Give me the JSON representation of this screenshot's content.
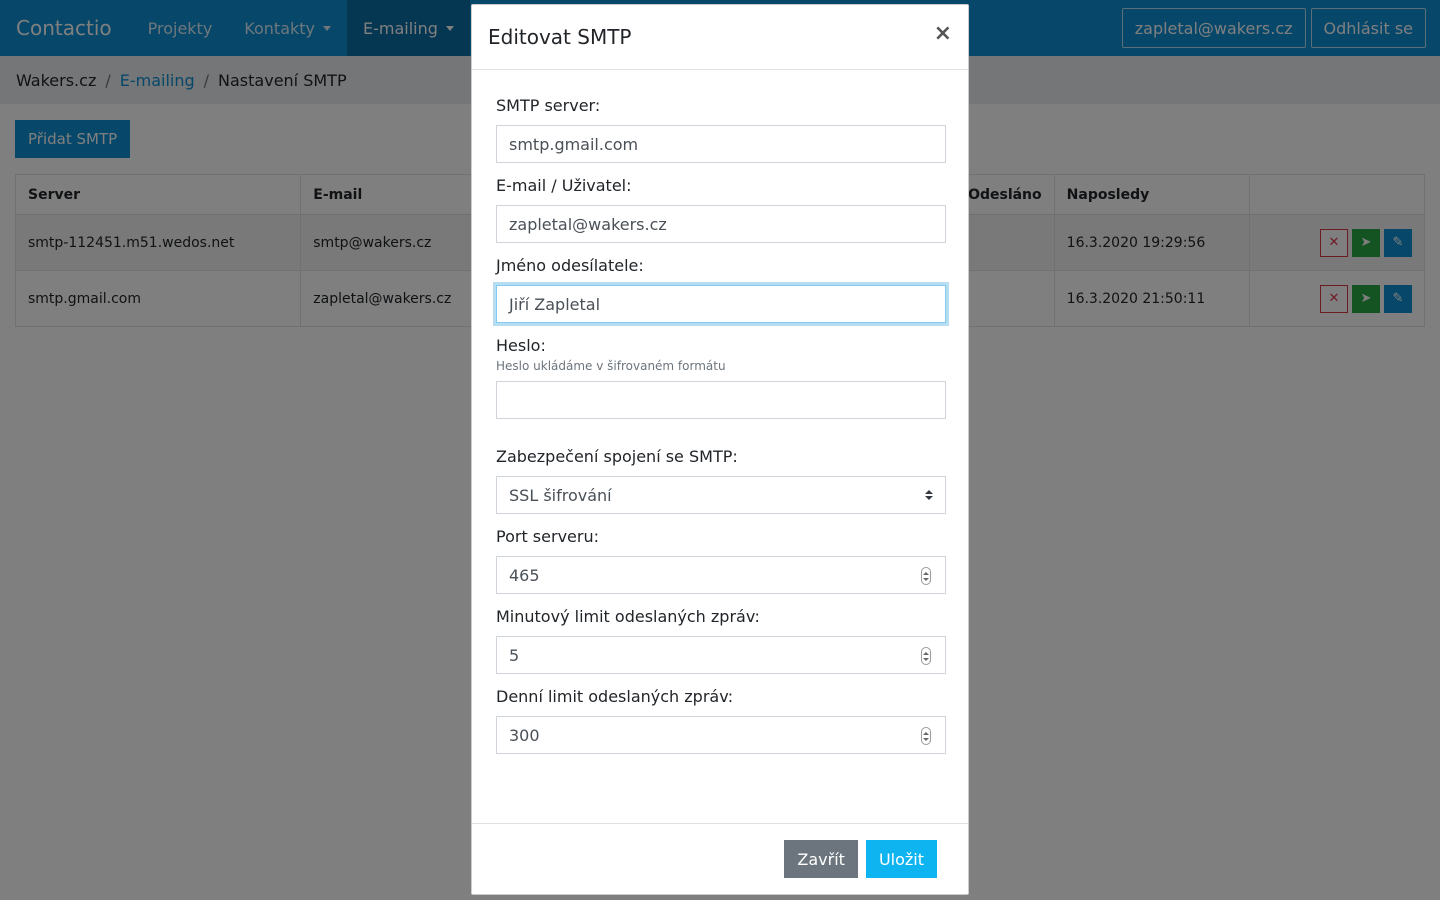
{
  "navbar": {
    "brand": "Contactio",
    "items": [
      {
        "label": "Projekty"
      },
      {
        "label": "Kontakty"
      },
      {
        "label": "E-mailing"
      }
    ],
    "user_email": "zapletal@wakers.cz",
    "logout_label": "Odhlásit se"
  },
  "breadcrumb": {
    "items": [
      "Wakers.cz",
      "E-mailing",
      "Nastavení SMTP"
    ],
    "separator": "/"
  },
  "add_button_label": "Přidat SMTP",
  "table": {
    "headers": [
      "Server",
      "E-mail",
      "",
      "Odesláno",
      "Naposledy",
      ""
    ],
    "visible_header_partial": "eslano",
    "rows": [
      {
        "server": "smtp-112451.m51.wedos.net",
        "email": "smtp@wakers.cz",
        "last": "16.3.2020 19:29:56"
      },
      {
        "server": "smtp.gmail.com",
        "email": "zapletal@wakers.cz",
        "last": "16.3.2020 21:50:11"
      }
    ]
  },
  "modal": {
    "title": "Editovat SMTP",
    "close_symbol": "×",
    "fields": {
      "smtp_server": {
        "label": "SMTP server:",
        "value": "smtp.gmail.com"
      },
      "email_user": {
        "label": "E-mail / Uživatel:",
        "value": "zapletal@wakers.cz"
      },
      "sender_name": {
        "label": "Jméno odesílatele:",
        "value": "Jiří Zapletal"
      },
      "password": {
        "label": "Heslo:",
        "help": "Heslo ukládáme v šifrovaném formátu",
        "value": ""
      },
      "security": {
        "label": "Zabezpečení spojení se SMTP:",
        "value": "SSL šifrování"
      },
      "port": {
        "label": "Port serveru:",
        "value": "465"
      },
      "minute_limit": {
        "label": "Minutový limit odeslaných zpráv:",
        "value": "5"
      },
      "daily_limit": {
        "label": "Denní limit odeslaných zpráv:",
        "value": "300"
      }
    },
    "close_button_label": "Zavřít",
    "save_button_label": "Uložit"
  },
  "colors": {
    "primary": "#0d8fd4",
    "nav_active": "#0a6ea4",
    "danger": "#dc3545",
    "success": "#28a745",
    "secondary": "#6c757d",
    "save": "#0db4f0"
  }
}
